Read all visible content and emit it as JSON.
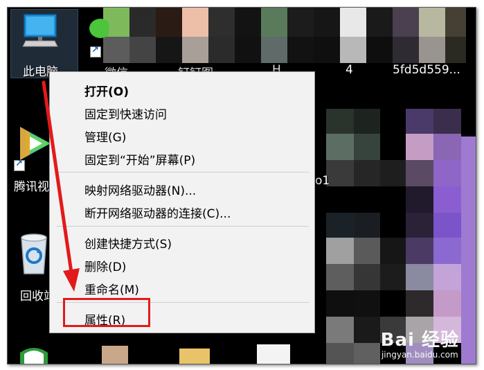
{
  "desktop": {
    "icons": [
      {
        "label": "此电脑",
        "icon": "computer-icon"
      },
      {
        "label": "腾讯视",
        "icon": "video-app-icon"
      },
      {
        "label": "回收站",
        "icon": "recycle-bin-icon"
      }
    ],
    "partial_labels": [
      "微信",
      "钉钉图",
      "H",
      "4",
      "5fd5d559...",
      "o1"
    ]
  },
  "context_menu": {
    "groups": [
      [
        "打开(O)",
        "固定到快速访问",
        "管理(G)",
        "固定到“开始”屏幕(P)"
      ],
      [
        "映射网络驱动器(N)...",
        "断开网络驱动器的连接(C)..."
      ],
      [
        "创建快捷方式(S)",
        "删除(D)",
        "重命名(M)"
      ],
      [
        "属性(R)"
      ]
    ],
    "default_item": "打开(O)",
    "highlighted_item": "属性(R)"
  },
  "annotation": {
    "color": "#e21a1a"
  },
  "watermark": {
    "main": "Bai 经验",
    "sub": "jingyan.baidu.com"
  }
}
